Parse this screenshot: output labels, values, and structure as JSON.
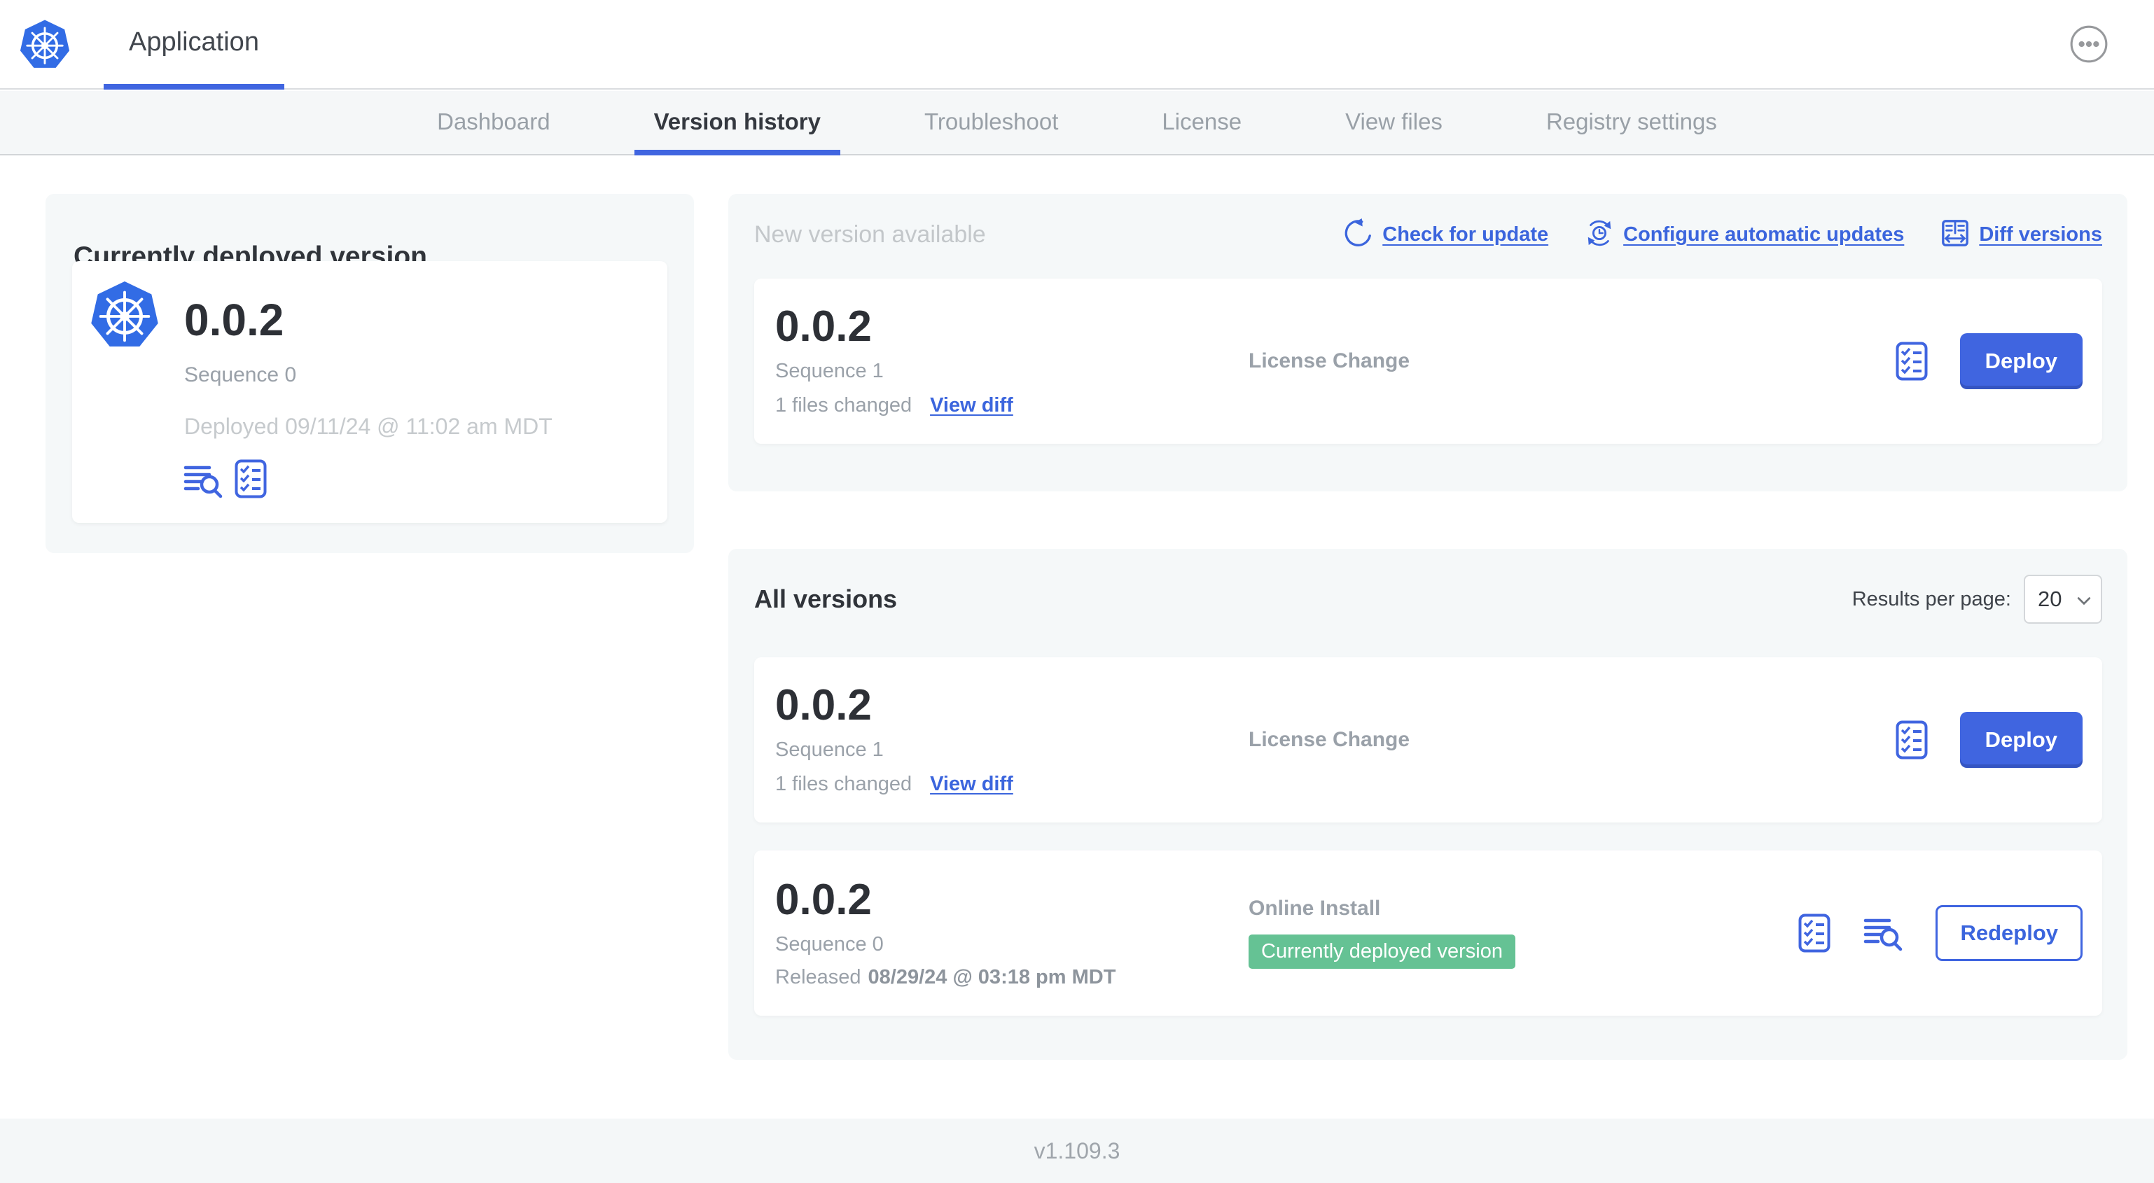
{
  "colors": {
    "primary_blue": "#4065e0",
    "link_blue": "#3b65dd",
    "badge_green": "#65c294",
    "panel_bg": "#f5f8f9",
    "kubernetes_blue": "#326ce5"
  },
  "header": {
    "app_title": "Application"
  },
  "tabs": [
    {
      "label": "Dashboard"
    },
    {
      "label": "Version history",
      "active": true
    },
    {
      "label": "Troubleshoot"
    },
    {
      "label": "License"
    },
    {
      "label": "View files"
    },
    {
      "label": "Registry settings"
    }
  ],
  "currently_deployed": {
    "title": "Currently deployed version",
    "version": "0.0.2",
    "sequence": "Sequence 0",
    "deployed_at": "Deployed 09/11/24 @ 11:02 am MDT"
  },
  "new_version_panel": {
    "title": "New version available",
    "actions": {
      "check_for_update": "Check for update",
      "configure_automatic_updates": "Configure automatic updates",
      "diff_versions": "Diff versions"
    },
    "row": {
      "version": "0.0.2",
      "sequence": "Sequence 1",
      "files_changed": "1 files changed",
      "view_diff": "View diff",
      "source": "License Change",
      "action": "Deploy"
    }
  },
  "all_versions_panel": {
    "title": "All versions",
    "results_per_page_label": "Results per page:",
    "results_per_page_value": "20",
    "rows": [
      {
        "version": "0.0.2",
        "sequence": "Sequence 1",
        "files_changed": "1 files changed",
        "view_diff": "View diff",
        "source": "License Change",
        "action": "Deploy"
      },
      {
        "version": "0.0.2",
        "sequence": "Sequence 0",
        "released_prefix": "Released",
        "released_date": "08/29/24 @ 03:18 pm MDT",
        "source": "Online Install",
        "badge": "Currently deployed version",
        "action": "Redeploy"
      }
    ]
  },
  "footer": {
    "console_version": "v1.109.3"
  }
}
